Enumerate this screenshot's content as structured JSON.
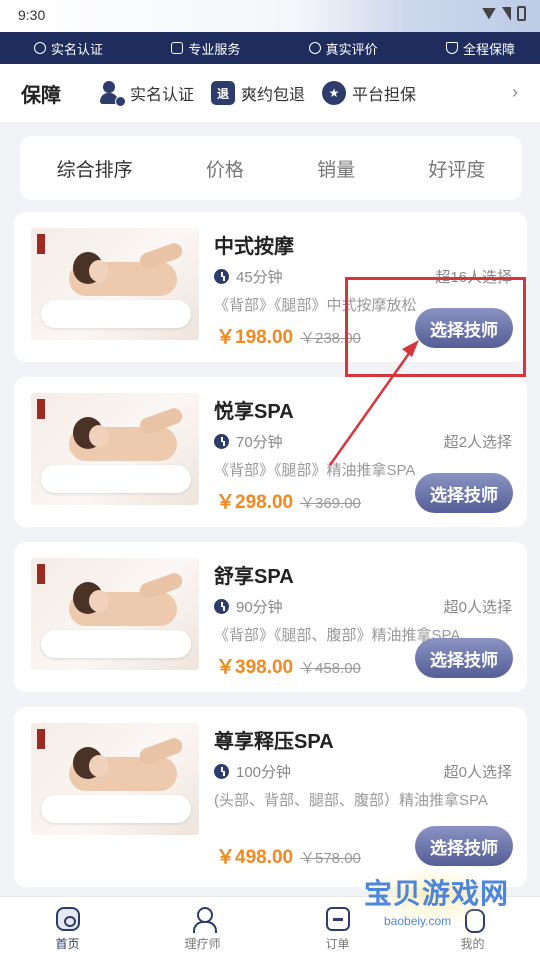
{
  "status_bar": {
    "time": "9:30"
  },
  "trust_bar": {
    "items": [
      {
        "label": "实名认证",
        "icon": "person-outline-icon"
      },
      {
        "label": "专业服务",
        "icon": "id-card-icon"
      },
      {
        "label": "真实评价",
        "icon": "comment-icon"
      },
      {
        "label": "全程保障",
        "icon": "shield-check-icon"
      }
    ]
  },
  "guarantee": {
    "title": "保障",
    "items": [
      {
        "label": "实名认证",
        "icon": "verified-person-icon",
        "glyph": ""
      },
      {
        "label": "爽约包退",
        "icon": "refund-icon",
        "glyph": "退"
      },
      {
        "label": "平台担保",
        "icon": "medal-icon",
        "glyph": "★"
      }
    ],
    "more": "›"
  },
  "sort_tabs": [
    "综合排序",
    "价格",
    "销量",
    "好评度"
  ],
  "services": [
    {
      "name": "中式按摩",
      "duration": "45分钟",
      "count": "超16人选择",
      "desc": "《背部》《腿部》中式按摩放松",
      "price": "￥198.00",
      "old_price": "￥238.00",
      "button": "选择技师"
    },
    {
      "name": "悦享SPA",
      "duration": "70分钟",
      "count": "超2人选择",
      "desc": "《背部》《腿部》精油推拿SPA",
      "price": "￥298.00",
      "old_price": "￥369.00",
      "button": "选择技师"
    },
    {
      "name": "舒享SPA",
      "duration": "90分钟",
      "count": "超0人选择",
      "desc": "《背部》《腿部、腹部》精油推拿SPA",
      "price": "￥398.00",
      "old_price": "￥458.00",
      "button": "选择技师"
    },
    {
      "name": "尊享释压SPA",
      "duration": "100分钟",
      "count": "超0人选择",
      "desc": "(头部、背部、腿部、腹部）精油推拿SPA",
      "price": "￥498.00",
      "old_price": "￥578.00",
      "button": "选择技师"
    }
  ],
  "bottom_nav": [
    {
      "label": "首页",
      "icon": "home-icon",
      "active": true
    },
    {
      "label": "理疗师",
      "icon": "technician-icon",
      "active": false
    },
    {
      "label": "订单",
      "icon": "order-icon",
      "active": false
    },
    {
      "label": "我的",
      "icon": "profile-icon",
      "active": false
    }
  ],
  "watermark": {
    "text": "宝贝游戏网",
    "url": "baobeiy.com"
  },
  "colors": {
    "brand": "#1e2d5e",
    "price": "#f08a1e",
    "button": "#555e96",
    "annotation": "#d5363b"
  }
}
